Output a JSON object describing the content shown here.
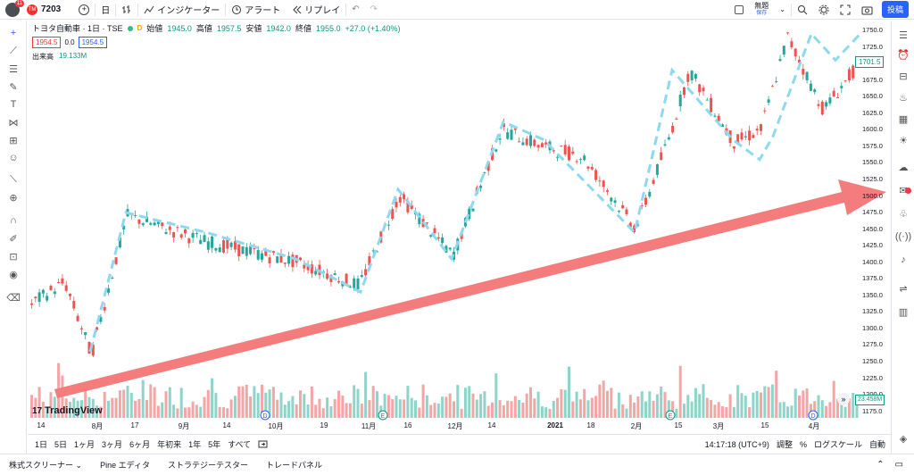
{
  "header": {
    "notification_count": "11",
    "symbol_flag": "TM",
    "symbol": "7203",
    "add_symbol": "+",
    "interval": "日",
    "chart_type": "bar-chart-icon",
    "indicators": "インジケーター",
    "alert": "アラート",
    "replay": "リプレイ",
    "undo": "↶",
    "redo": "↷",
    "layout_name": "無題",
    "layout_sub": "保存",
    "post": "投稿"
  },
  "legend": {
    "title": "トヨタ自動車 · 1日 · TSE",
    "d_label": "D",
    "open_label": "始値",
    "open": "1945.0",
    "high_label": "高値",
    "high": "1957.5",
    "low_label": "安値",
    "low": "1942.0",
    "close_label": "終値",
    "close": "1955.0",
    "change": "+27.0 (+1.40%)",
    "sell_price": "1954.5",
    "spread": "0.0",
    "buy_price": "1954.5",
    "volume_label": "出来高",
    "volume": "19.133M"
  },
  "price_axis": {
    "labels": [
      "1750.0",
      "1725.0",
      "1700.0",
      "1675.0",
      "1650.0",
      "1625.0",
      "1600.0",
      "1575.0",
      "1550.0",
      "1525.0",
      "1500.0",
      "1475.0",
      "1450.0",
      "1425.0",
      "1400.0",
      "1375.0",
      "1350.0",
      "1325.0",
      "1300.0",
      "1275.0",
      "1250.0",
      "1225.0",
      "1200.0",
      "1175.0"
    ],
    "last_price": "1701.5",
    "last_volume": "23.458M"
  },
  "time_axis": {
    "labels": [
      "14",
      "8月",
      "17",
      "9月",
      "14",
      "10月",
      "19",
      "11月",
      "16",
      "12月",
      "14",
      "2021",
      "18",
      "2月",
      "15",
      "3月",
      "15",
      "4月"
    ],
    "event_markers": [
      "D",
      "E",
      "E",
      "D"
    ]
  },
  "branding": {
    "logo_mark": "17",
    "logo_text": "TradingView"
  },
  "range_bar": {
    "ranges": [
      "1日",
      "5日",
      "1ヶ月",
      "3ヶ月",
      "6ヶ月",
      "年初来",
      "1年",
      "5年",
      "すべて"
    ],
    "goto_icon": "calendar-range-icon",
    "clock": "14:17:18 (UTC+9)",
    "adjust": "調整",
    "percent": "%",
    "log_scale": "ログスケール",
    "auto": "自動"
  },
  "bottom_tabs": {
    "tabs": [
      "株式スクリーナー",
      "Pine エディタ",
      "ストラテジーテスター",
      "トレードパネル"
    ],
    "expand": "⌃",
    "maximize": "▭"
  },
  "colors": {
    "up": "#26a69a",
    "down": "#ef5350",
    "vol_up": "#8fd4c9",
    "vol_down": "#f4a5a5",
    "trend_dash": "#8ed8f0",
    "trend_arrow": "#f47c7c",
    "accent": "#2962ff"
  }
}
